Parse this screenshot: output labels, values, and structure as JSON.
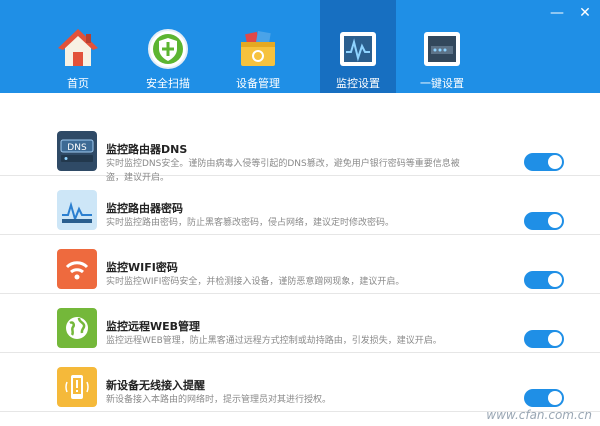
{
  "window": {
    "minimize_label": "—",
    "close_label": "✕"
  },
  "nav": {
    "items": [
      {
        "label": "首页",
        "icon": "home-icon",
        "active": false
      },
      {
        "label": "安全扫描",
        "icon": "shield-icon",
        "active": false
      },
      {
        "label": "设备管理",
        "icon": "device-box-icon",
        "active": false
      },
      {
        "label": "监控设置",
        "icon": "monitor-icon",
        "active": true
      },
      {
        "label": "一键设置",
        "icon": "router-icon",
        "active": false
      }
    ]
  },
  "settings": [
    {
      "title": "监控路由器DNS",
      "desc": "实时监控DNS安全。谨防由病毒入侵等引起的DNS篡改，避免用户银行密码等重要信息被盗，建议开启。",
      "icon": "dns-icon",
      "enabled": true
    },
    {
      "title": "监控路由器密码",
      "desc": "实时监控路由密码，防止黑客篡改密码，侵占网络，建议定时修改密码。",
      "icon": "router-password-icon",
      "enabled": true
    },
    {
      "title": "监控WIFI密码",
      "desc": "实时监控WIFI密码安全，并检测接入设备，谨防恶意蹭网现象，建议开启。",
      "icon": "wifi-icon",
      "enabled": true
    },
    {
      "title": "监控远程WEB管理",
      "desc": "监控远程WEB管理，防止黑客通过远程方式控制或劫持路由，引发损失，建议开启。",
      "icon": "globe-icon",
      "enabled": true
    },
    {
      "title": "新设备无线接入提醒",
      "desc": "新设备接入本路由的网络时，提示管理员对其进行授权。",
      "icon": "phone-alert-icon",
      "enabled": true
    }
  ],
  "watermark": "www.cfan.com.cn",
  "colors": {
    "header": "#1f8fe6",
    "active_tab": "#176fc1",
    "toggle_on": "#1f8fe6"
  }
}
